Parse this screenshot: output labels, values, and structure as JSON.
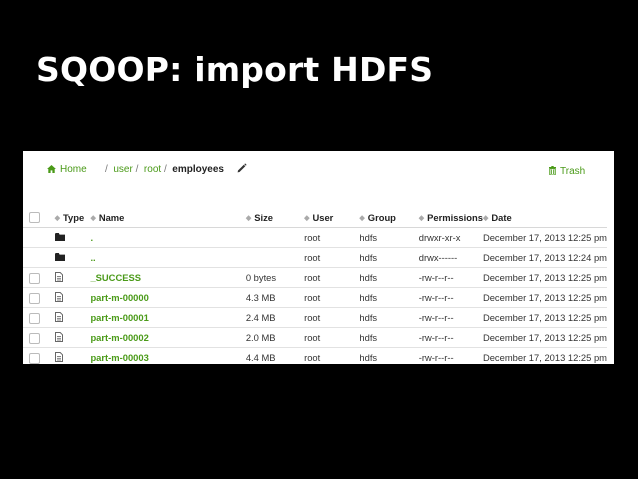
{
  "slide": {
    "title": "SQOOP: import HDFS"
  },
  "browser": {
    "breadcrumb": {
      "home": "Home",
      "sep": "/",
      "segments": [
        "user",
        "root",
        "employees"
      ]
    },
    "trash_label": "Trash",
    "columns": {
      "type": "Type",
      "name": "Name",
      "size": "Size",
      "user": "User",
      "group": "Group",
      "permissions": "Permissions",
      "date": "Date"
    },
    "rows": [
      {
        "kind": "folder",
        "name": ".",
        "size": "",
        "user": "root",
        "group": "hdfs",
        "permissions": "drwxr-xr-x",
        "date": "December 17, 2013 12:25 pm"
      },
      {
        "kind": "folder",
        "name": "..",
        "size": "",
        "user": "root",
        "group": "hdfs",
        "permissions": "drwx------",
        "date": "December 17, 2013 12:24 pm"
      },
      {
        "kind": "file",
        "name": "_SUCCESS",
        "size": "0 bytes",
        "user": "root",
        "group": "hdfs",
        "permissions": "-rw-r--r--",
        "date": "December 17, 2013 12:25 pm"
      },
      {
        "kind": "file",
        "name": "part-m-00000",
        "size": "4.3 MB",
        "user": "root",
        "group": "hdfs",
        "permissions": "-rw-r--r--",
        "date": "December 17, 2013 12:25 pm"
      },
      {
        "kind": "file",
        "name": "part-m-00001",
        "size": "2.4 MB",
        "user": "root",
        "group": "hdfs",
        "permissions": "-rw-r--r--",
        "date": "December 17, 2013 12:25 pm"
      },
      {
        "kind": "file",
        "name": "part-m-00002",
        "size": "2.0 MB",
        "user": "root",
        "group": "hdfs",
        "permissions": "-rw-r--r--",
        "date": "December 17, 2013 12:25 pm"
      },
      {
        "kind": "file",
        "name": "part-m-00003",
        "size": "4.4 MB",
        "user": "root",
        "group": "hdfs",
        "permissions": "-rw-r--r--",
        "date": "December 17, 2013 12:25 pm"
      }
    ],
    "icons": {
      "home": "home-icon",
      "edit": "pencil-icon",
      "trash": "trash-icon",
      "folder": "folder-icon",
      "file": "file-icon",
      "sort": "sort-icon",
      "checkbox": "checkbox-icon"
    },
    "colors": {
      "link": "#4a9a18",
      "text": "#333333",
      "background": "#ffffff",
      "slide_background": "#000000"
    }
  }
}
